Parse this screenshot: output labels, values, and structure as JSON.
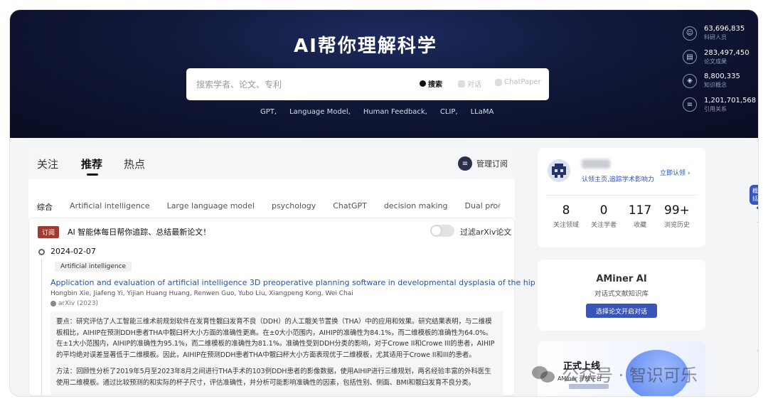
{
  "hero": {
    "title": "AI帮你理解科学",
    "search_placeholder": "搜索学者、论文、专利",
    "search_btn": "搜索",
    "dialog_btn": "对话",
    "chatpaper_btn": "ChatPaper",
    "keywords": [
      "GPT,",
      "Language Model,",
      "Human Feedback,",
      "CLIP,",
      "LLaMA"
    ]
  },
  "stats": [
    {
      "icon": "researcher-icon",
      "glyph": "☺",
      "value": "63,696,835",
      "label": "科研人员"
    },
    {
      "icon": "paper-icon",
      "glyph": "▤",
      "value": "283,497,450",
      "label": "论文成果"
    },
    {
      "icon": "concept-icon",
      "glyph": "◈",
      "value": "8,800,335",
      "label": "知识概念"
    },
    {
      "icon": "citation-icon",
      "glyph": "≡",
      "value": "1,201,701,568",
      "label": "引用关系"
    }
  ],
  "tabs": [
    {
      "label": "关注"
    },
    {
      "label": "推荐",
      "active": true
    },
    {
      "label": "热点"
    }
  ],
  "manage_label": "管理订阅",
  "categories": [
    "综合",
    "Artificial intelligence",
    "Large language model",
    "psychology",
    "ChatGPT",
    "decision making",
    "Dual process th"
  ],
  "feed": {
    "sub_tag": "订阅",
    "sub_title": "AI 智能体每日帮你追踪、总结最新论文！",
    "filter_label": "过滤arXiv论文",
    "filter_on": false,
    "date": "2024-02-07",
    "paper_tag": "Artificial intelligence",
    "paper_title": "Application and evaluation of artificial intelligence 3D preoperative planning software in developmental dysplasia of the hip",
    "authors": "Hongbin Xie, Jiafeng Yi, Yijian Huang Huang, Renwen Guo, Yubo Liu, Xiangpeng Kong, Wei Chai",
    "venue": "arXiv (2023)",
    "summary_1": "要点：研究评估了人工智能三维术前规划软件在发育性髋臼发育不良（DDH）的人工髋关节置换（THA）中的应用和效果。研究结果表明，与二维模板相比，AIHIP在预测DDH患者THA中髋臼杯大小方面的准确性更高。在±0大小范围内，AIHIP的准确性为84.1%，而二维模板的准确性为64.0%。在±1大小范围内，AIHIP的准确性为95.1%，而二维模板的准确性为81.1%。准确性受到DDH分类的影响，对于Crowe II和Crowe III的患者，AIHIP的平均绝对误差显著低于二维模板。因此，AIHIP在预测DDH患者THA中髋臼杯大小方面表现优于二维模板，尤其适用于Crowe II和III的患者。",
    "summary_2": "方法：回顾性分析了2019年5月至2023年8月之间进行THA手术的103例DDH患者的影像数据，使用AIHIP进行三维规划，两名经验丰富的外科医生使用二维模板。通过比较预测的和实际的杯子尺寸，评估准确性，并分析可能影响准确性的因素，包括性别、侧面、BMI和髋臼发育不良分类。"
  },
  "profile": {
    "subtitle": "认领主页,追踪学术影响力",
    "verify": "立即认领",
    "stats": [
      {
        "value": "8",
        "label": "关注领域"
      },
      {
        "value": "0",
        "label": "关注学者"
      },
      {
        "value": "117",
        "label": "收藏"
      },
      {
        "value": "99+",
        "label": "浏览历史"
      }
    ]
  },
  "ai_card": {
    "title": "AMiner AI",
    "subtitle": "对话式文献知识库",
    "button": "选择论文开启对话"
  },
  "launch_card": {
    "title": "正式上线",
    "subtitle": "AMiner 开放平台"
  },
  "side_badge": "概括",
  "watermark": "公众号 · 智识可乐"
}
